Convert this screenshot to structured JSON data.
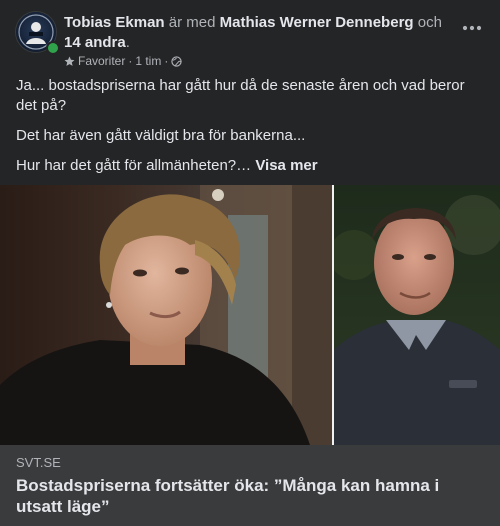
{
  "post": {
    "author": "Tobias Ekman",
    "with_text": "är med",
    "tagged": "Mathias Werner Denneberg",
    "and_text": "och",
    "others": "14 andra",
    "period": ".",
    "audience": "Favoriter",
    "separator": "·",
    "time": "1 tim",
    "separator2": "·",
    "more_icon": "more-horizontal-icon",
    "paragraphs": [
      "Ja... bostadspriserna har gått hur då de senaste åren och vad beror det på?",
      "Det har även gått väldigt bra för bankerna..."
    ],
    "last_paragraph": "Hur har det gått för allmänheten?…",
    "see_more": "Visa mer"
  },
  "link": {
    "domain": "SVT.SE",
    "headline": "Bostadspriserna fortsätter öka: ”Många kan hamna i utsatt läge”"
  },
  "colors": {
    "background": "#242526",
    "card": "#3a3b3c",
    "text_primary": "#e4e6eb",
    "text_secondary": "#b0b3b8",
    "online": "#31a24c"
  }
}
